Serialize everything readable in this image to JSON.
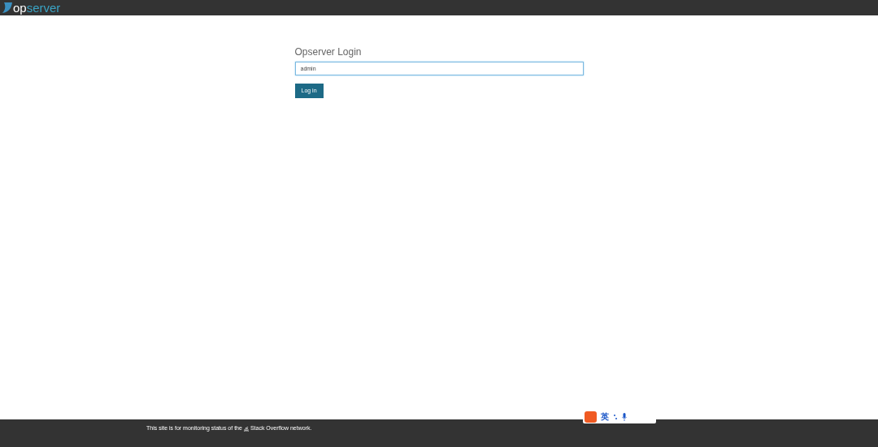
{
  "header": {
    "logo": {
      "prefix": "op",
      "suffix": "server"
    }
  },
  "login": {
    "title": "Opserver Login",
    "username": {
      "value": "admin"
    },
    "submit": "Log in"
  },
  "footer": {
    "text_before": "This site is for monitoring status of the",
    "text_after": "Stack Overflow network."
  },
  "ime_toolbar": {
    "mode": "英"
  }
}
